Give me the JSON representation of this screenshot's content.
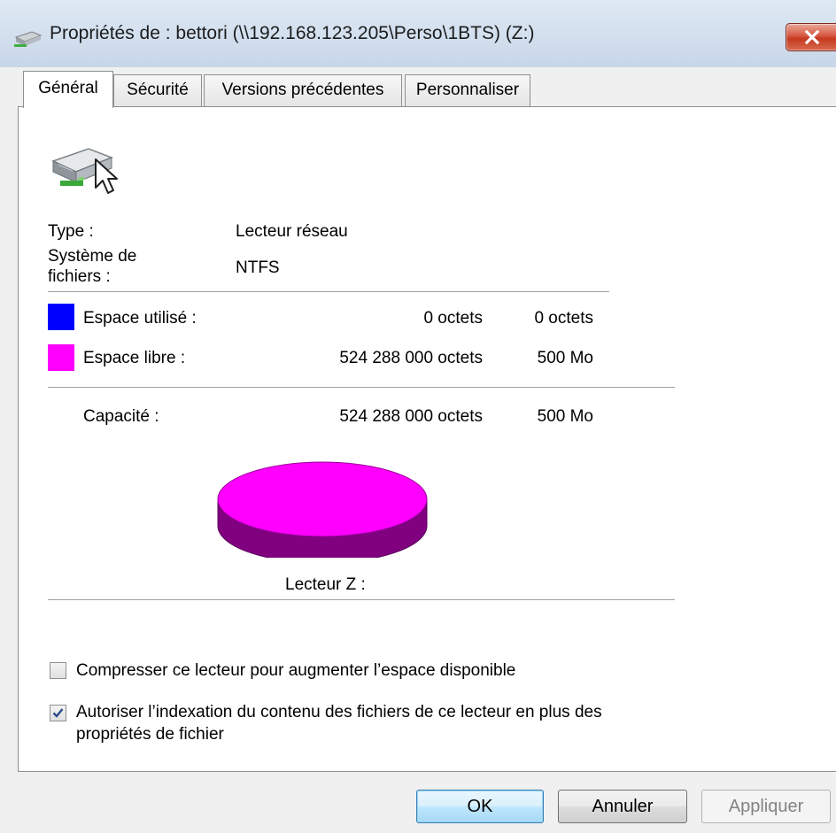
{
  "window": {
    "title": "Propriétés de : bettori (\\\\192.168.123.205\\Perso\\1BTS) (Z:)"
  },
  "tabs": [
    {
      "label": "Général",
      "active": true
    },
    {
      "label": "Sécurité",
      "active": false
    },
    {
      "label": "Versions précédentes",
      "active": false
    },
    {
      "label": "Personnaliser",
      "active": false
    }
  ],
  "general": {
    "type_label": "Type :",
    "type_value": "Lecteur réseau",
    "fs_label_line1": "Système de",
    "fs_label_line2": "fichiers :",
    "fs_value": "NTFS"
  },
  "space": {
    "used": {
      "label": "Espace utilisé :",
      "bytes": "0 octets",
      "size": "0 octets",
      "color": "#0000ff"
    },
    "free": {
      "label": "Espace libre :",
      "bytes": "524 288 000 octets",
      "size": "500 Mo",
      "color": "#ff00ff"
    },
    "capacity": {
      "label": "Capacité :",
      "bytes": "524 288 000 octets",
      "size": "500 Mo"
    }
  },
  "chart_data": {
    "type": "pie",
    "categories": [
      "Espace utilisé",
      "Espace libre"
    ],
    "values": [
      0,
      524288000
    ],
    "colors": [
      "#0000ff",
      "#ff00ff"
    ],
    "label": "Lecteur Z :"
  },
  "options": {
    "compress": {
      "label": "Compresser ce lecteur pour augmenter l’espace disponible",
      "checked": false
    },
    "index": {
      "label_line1": "Autoriser l’indexation du contenu des fichiers de ce lecteur en plus des",
      "label_line2": "propriétés de fichier",
      "checked": true
    }
  },
  "buttons": {
    "ok": "OK",
    "cancel": "Annuler",
    "apply": "Appliquer"
  },
  "icons": {
    "title": "network-drive-icon",
    "drive": "network-drive-icon",
    "close": "close-icon"
  }
}
